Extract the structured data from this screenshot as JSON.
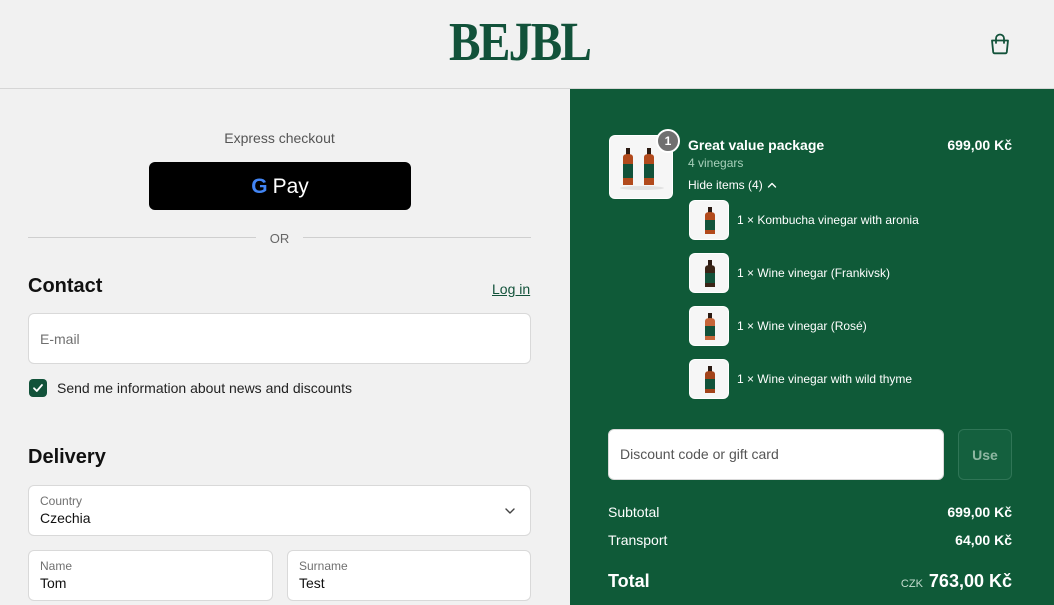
{
  "header": {
    "logo": "BEJBL",
    "cart_icon": "shopping-bag-icon"
  },
  "express": {
    "label": "Express checkout",
    "gpay_g": "G",
    "gpay_text": "Pay",
    "or": "OR"
  },
  "contact": {
    "title": "Contact",
    "login": "Log in",
    "email_placeholder": "E-mail",
    "newsletter_label": "Send me information about news and discounts",
    "newsletter_checked": true
  },
  "delivery": {
    "title": "Delivery",
    "country_label": "Country",
    "country_value": "Czechia",
    "name_label": "Name",
    "name_value": "Tom",
    "surname_label": "Surname",
    "surname_value": "Test"
  },
  "order": {
    "product": {
      "quantity_badge": "1",
      "title": "Great value package",
      "subtitle": "4 vinegars",
      "price": "699,00 Kč",
      "hide_items": "Hide items (4)"
    },
    "items": [
      {
        "label": "1 × Kombucha vinegar with aronia"
      },
      {
        "label": "1 × Wine vinegar (Frankivsk)"
      },
      {
        "label": "1 × Wine vinegar (Rosé)"
      },
      {
        "label": "1 × Wine vinegar with wild thyme"
      }
    ],
    "discount_placeholder": "Discount code or gift card",
    "use_button": "Use",
    "subtotal_label": "Subtotal",
    "subtotal_value": "699,00 Kč",
    "transport_label": "Transport",
    "transport_value": "64,00 Kč",
    "total_label": "Total",
    "total_currency": "CZK",
    "total_value": "763,00 Kč"
  },
  "colors": {
    "brand_green": "#12523a",
    "panel_green": "#0f5a38"
  }
}
